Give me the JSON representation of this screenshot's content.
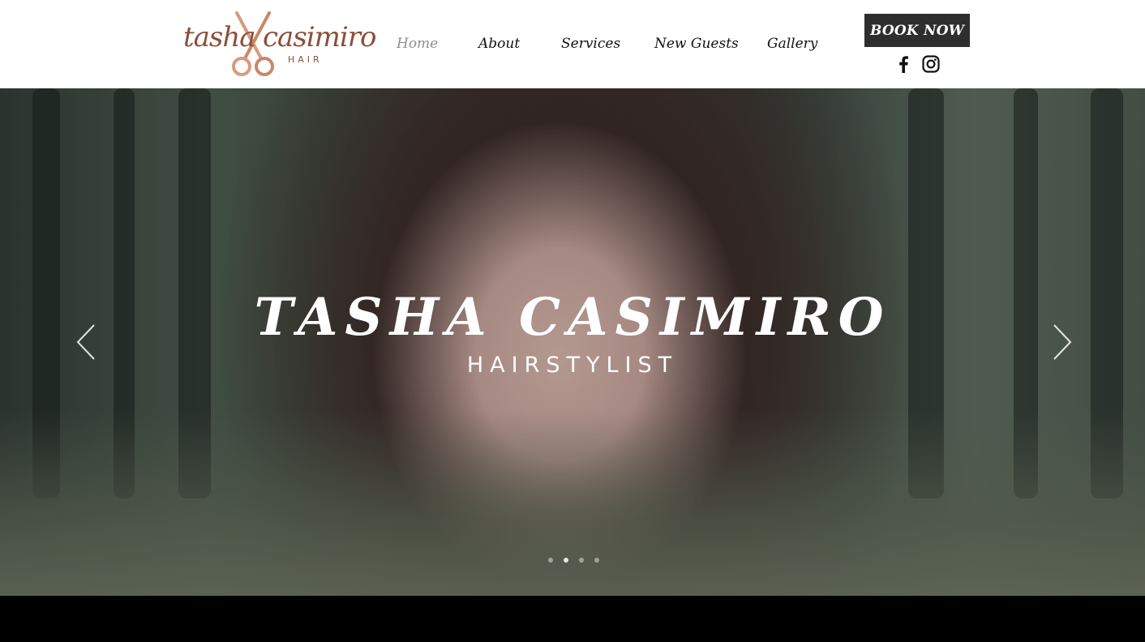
{
  "logo": {
    "word1": "tasha",
    "word2": "casimiro",
    "sub": "HAIR",
    "color": "#8a4f3a"
  },
  "nav": {
    "items": [
      {
        "label": "Home",
        "active": true
      },
      {
        "label": "About",
        "active": false
      },
      {
        "label": "Services",
        "active": false
      },
      {
        "label": "New Guests",
        "active": false
      },
      {
        "label": "Gallery",
        "active": false
      }
    ]
  },
  "header": {
    "book_label": "BOOK NOW"
  },
  "social": {
    "icons": [
      "facebook-icon",
      "instagram-icon"
    ]
  },
  "hero": {
    "title": "TASHA CASIMIRO",
    "subtitle": "HAIRSTYLIST",
    "slides_count": 4,
    "active_slide": 2
  },
  "colors": {
    "button_bg": "#2e2e2e",
    "nav_active": "#8e8e8e",
    "text": "#111111"
  }
}
